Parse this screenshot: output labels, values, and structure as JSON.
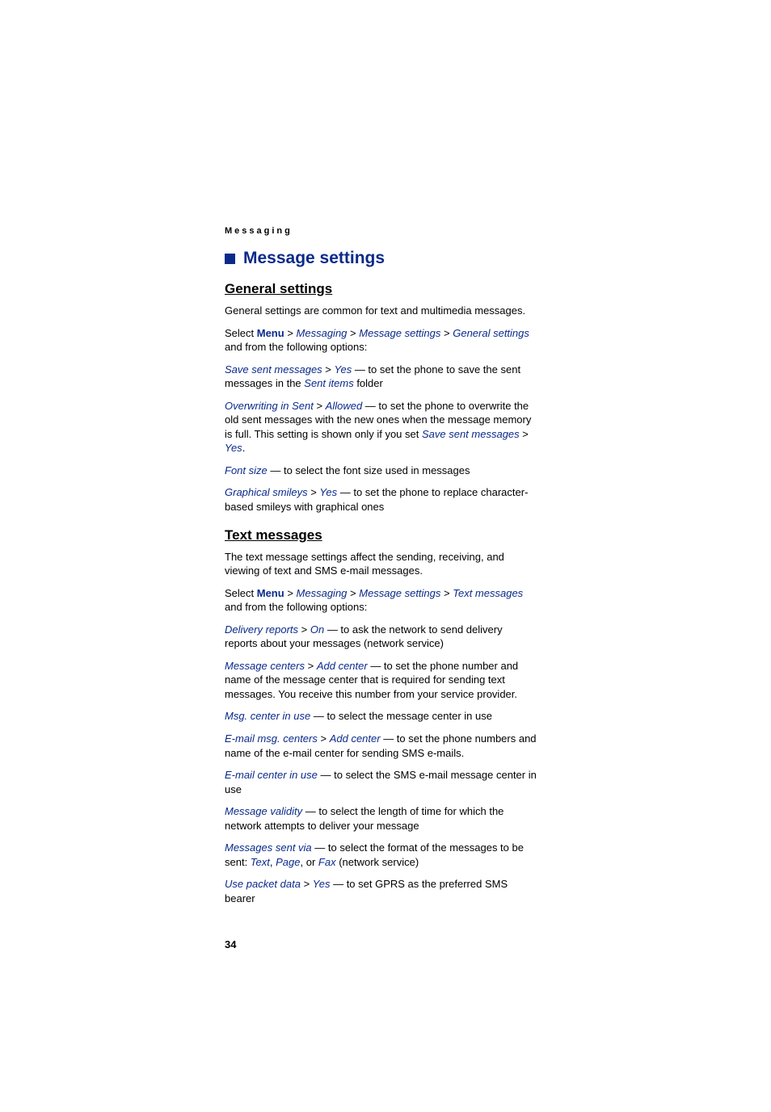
{
  "running_header": "Messaging",
  "h1": "Message settings",
  "sections": {
    "general": {
      "title": "General settings",
      "intro": "General settings are common for text and multimedia messages.",
      "select_prefix": "Select ",
      "menu": "Menu",
      "sep": " > ",
      "messaging": "Messaging",
      "message_settings": "Message settings",
      "general_settings": "General settings",
      "select_suffix": " and from the following options:",
      "opt1": {
        "a": "Save sent messages",
        "b": "Yes",
        "text": " — to set the phone to save the sent messages in the ",
        "c": "Sent items",
        "tail": " folder"
      },
      "opt2": {
        "a": "Overwriting in Sent",
        "b": "Allowed",
        "text1": " — to set the phone to overwrite the old sent messages with the new ones when the message memory is full. This setting is shown only if you set ",
        "c": "Save sent messages",
        "d": "Yes",
        "tail": "."
      },
      "opt3": {
        "a": "Font size",
        "text": " — to select the font size used in messages"
      },
      "opt4": {
        "a": "Graphical smileys",
        "b": "Yes",
        "text": " — to set the phone to replace character-based smileys with graphical ones"
      }
    },
    "text": {
      "title": "Text messages",
      "intro": "The text message settings affect the sending, receiving, and viewing of text and SMS e-mail messages.",
      "select_prefix": "Select ",
      "menu": "Menu",
      "sep": " > ",
      "messaging": "Messaging",
      "message_settings": "Message settings",
      "text_messages": "Text messages",
      "select_suffix": " and from the following options:",
      "opt1": {
        "a": "Delivery reports",
        "b": "On",
        "text": " — to ask the network to send delivery reports about your messages (network service)"
      },
      "opt2": {
        "a": "Message centers",
        "b": "Add center",
        "text": " — to set the phone number and name of the message center that is required for sending text messages. You receive this number from your service provider."
      },
      "opt3": {
        "a": "Msg. center in use",
        "text": " — to select the message center in use"
      },
      "opt4": {
        "a": "E-mail msg. centers",
        "b": "Add center",
        "text": " — to set the phone numbers and name of the e-mail center for sending SMS e-mails."
      },
      "opt5": {
        "a": "E-mail center in use",
        "text": " — to select the SMS e-mail message center in use"
      },
      "opt6": {
        "a": "Message validity",
        "text": " — to select the length of time for which the network attempts to deliver your message"
      },
      "opt7": {
        "a": "Messages sent via",
        "text1": " — to select the format of the messages to be sent: ",
        "b": "Text",
        "comma1": ", ",
        "c": "Page",
        "comma2": ", or ",
        "d": "Fax",
        "tail": " (network service)"
      },
      "opt8": {
        "a": "Use packet data",
        "b": "Yes",
        "text": " — to set GPRS as the preferred SMS bearer"
      }
    }
  },
  "page_number": "34"
}
